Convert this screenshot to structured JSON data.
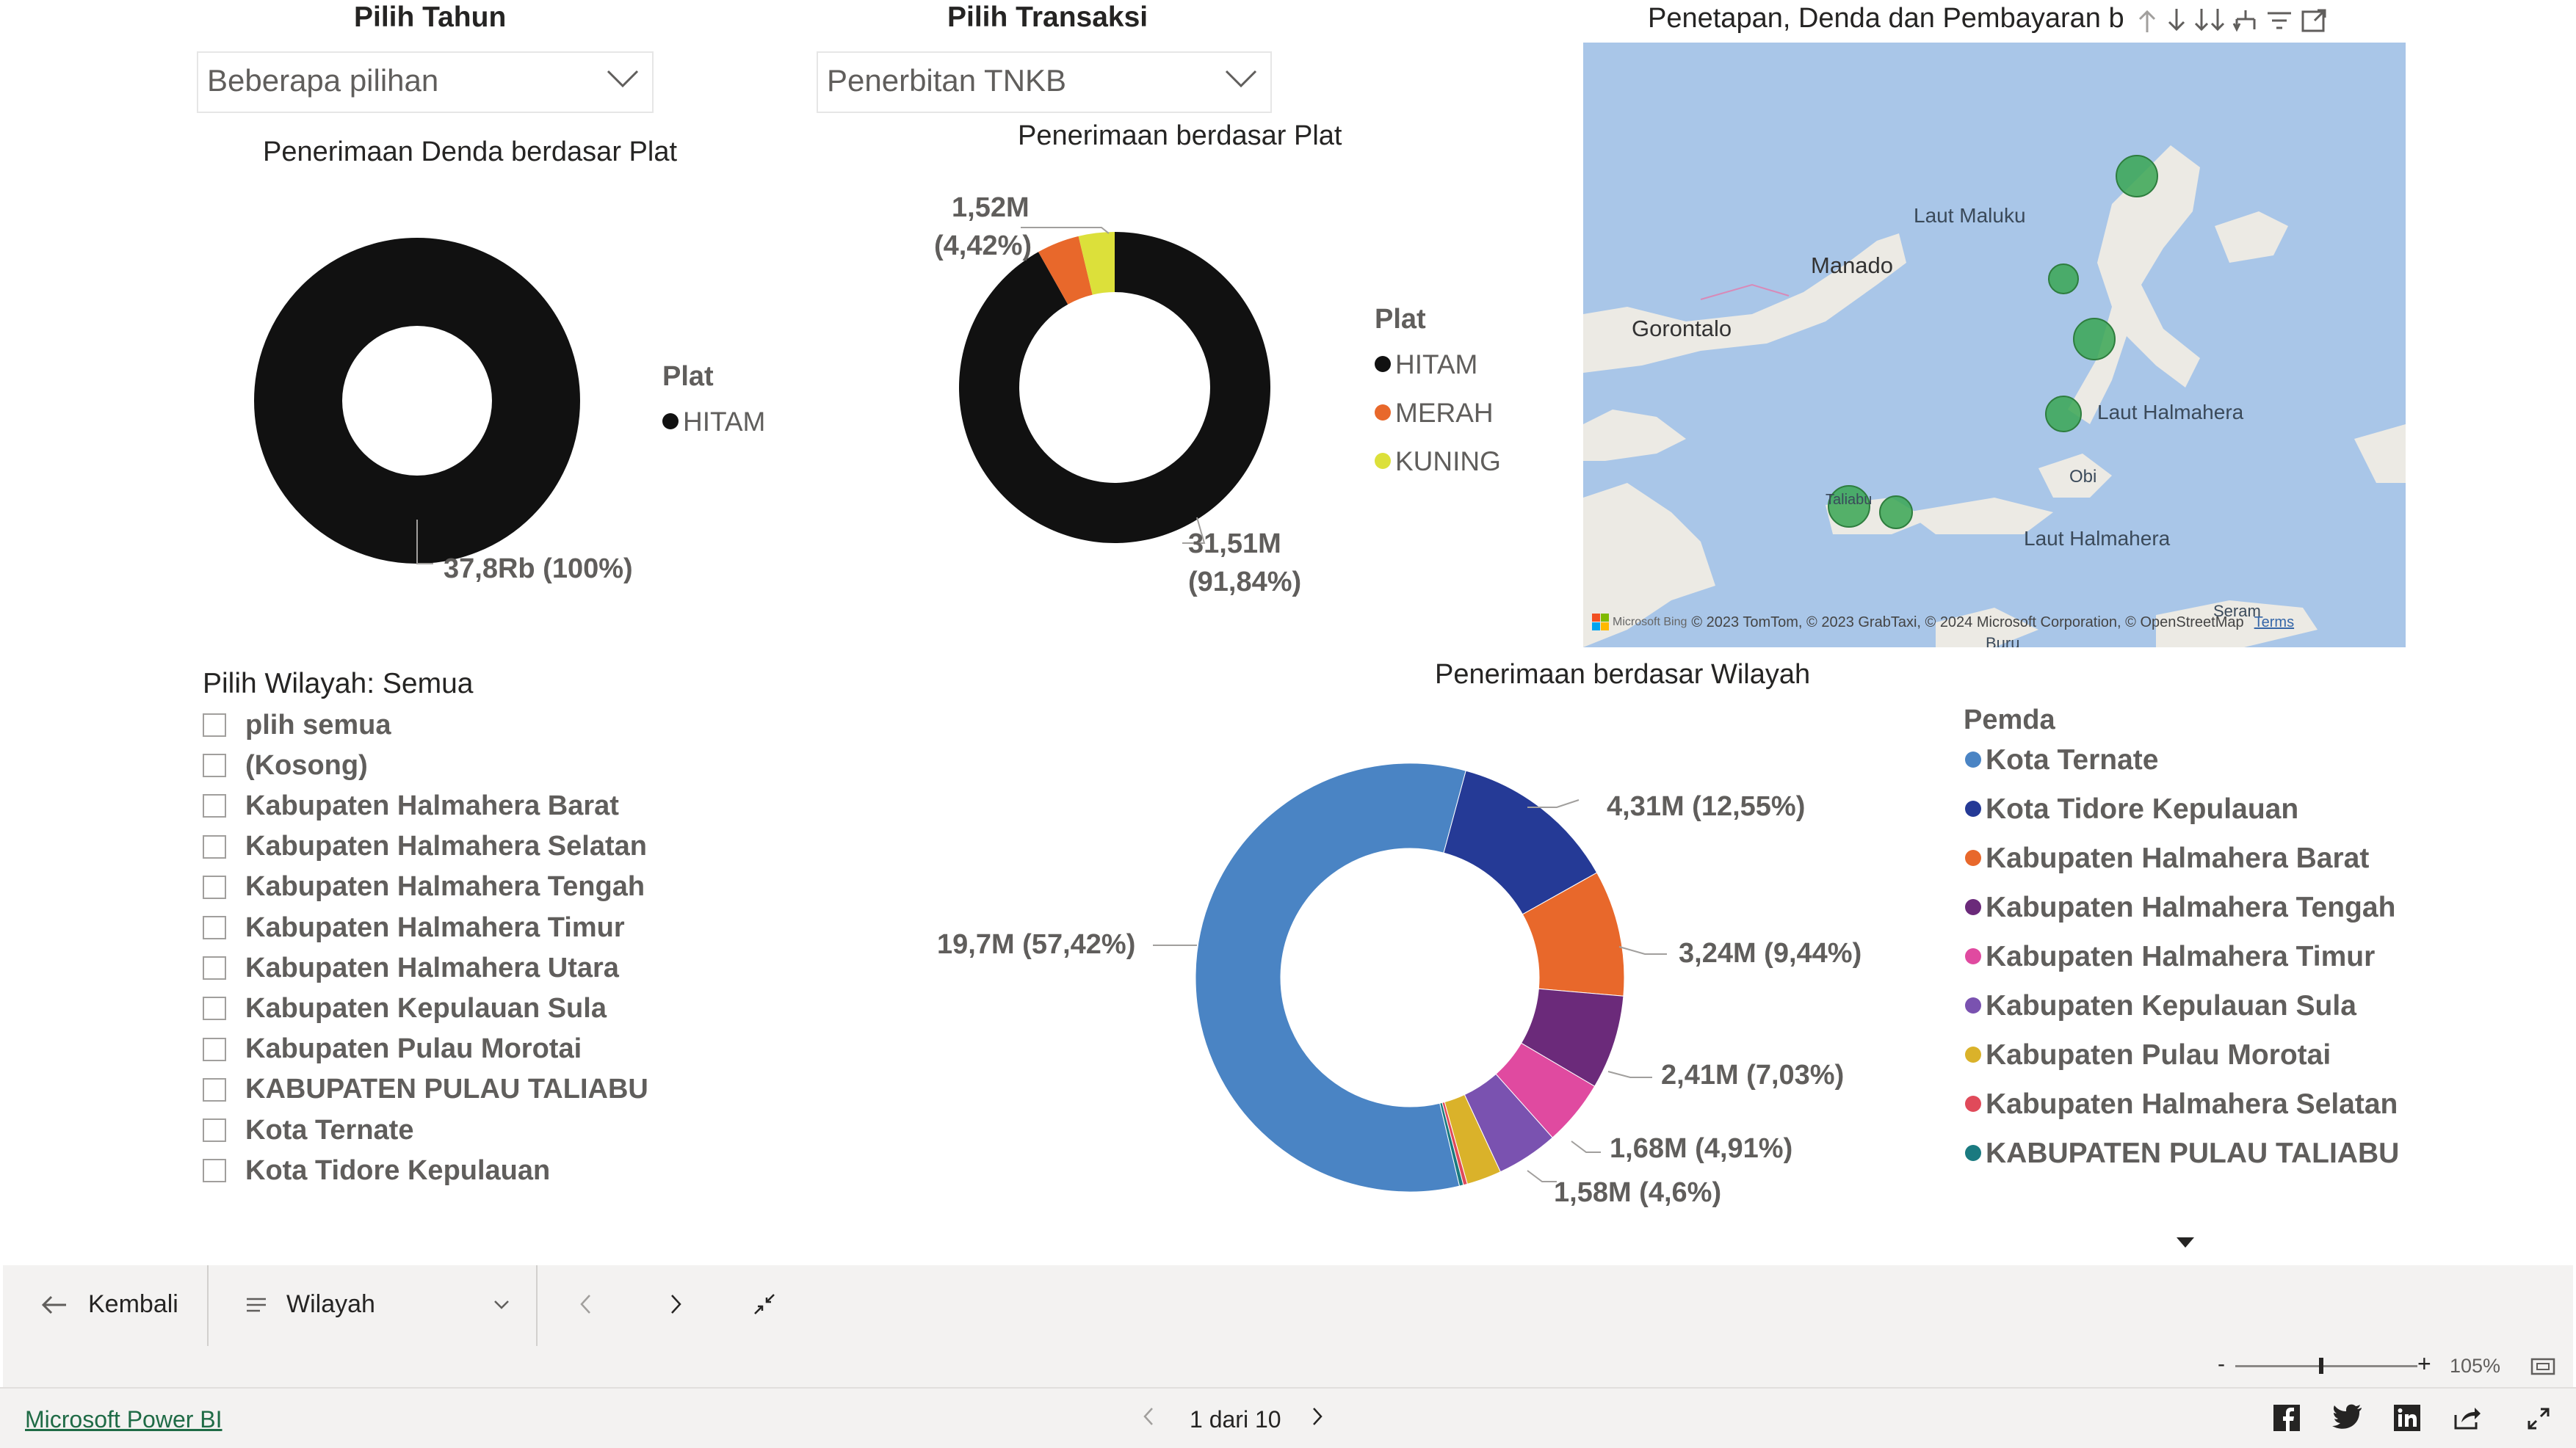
{
  "slicers": {
    "tahun": {
      "title": "Pilih Tahun",
      "value": "Beberapa pilihan"
    },
    "transaksi": {
      "title": "Pilih Transaksi",
      "value": "Penerbitan TNKB"
    }
  },
  "denda_chart": {
    "title": "Penerimaan Denda berdasar Plat",
    "legend_title": "Plat",
    "legend": [
      {
        "label": "HITAM",
        "color": "#111111"
      }
    ],
    "data_labels": [
      "37,8Rb (100%)"
    ]
  },
  "plat_chart": {
    "title": "Penerimaan berdasar Plat",
    "legend_title": "Plat",
    "legend": [
      {
        "label": "HITAM",
        "color": "#111111"
      },
      {
        "label": "MERAH",
        "color": "#e8682b"
      },
      {
        "label": "KUNING",
        "color": "#dce03a"
      }
    ],
    "data_labels": {
      "top_line1": "1,52M",
      "top_line2": "(4,42%)",
      "bottom_line1": "31,51M",
      "bottom_line2": "(91,84%)"
    }
  },
  "map": {
    "title": "Penetapan, Denda dan Pembayaran b",
    "places": {
      "laut_maluku": "Laut Maluku",
      "manado": "Manado",
      "gorontalo": "Gorontalo",
      "laut_halmahera_1": "Laut Halmahera",
      "obi": "Obi",
      "laut_halmahera_2": "Laut Halmahera",
      "taliabu": "Taliabu",
      "seram": "Seram",
      "buru": "Buru"
    },
    "attribution": "© 2023 TomTom, © 2023 GrabTaxi, © 2024 Microsoft Corporation, © OpenStreetMap",
    "terms": "Terms",
    "bing": "Microsoft Bing"
  },
  "wilayah_slicer": {
    "title": "Pilih Wilayah: Semua",
    "items": [
      "plih semua",
      "(Kosong)",
      "Kabupaten Halmahera Barat",
      "Kabupaten Halmahera Selatan",
      "Kabupaten Halmahera Tengah",
      "Kabupaten Halmahera Timur",
      "Kabupaten Halmahera Utara",
      "Kabupaten Kepulauan Sula",
      "Kabupaten Pulau Morotai",
      "KABUPATEN PULAU TALIABU",
      "Kota Ternate",
      "Kota Tidore Kepulauan"
    ]
  },
  "wilayah_chart": {
    "title": "Penerimaan berdasar Wilayah",
    "legend_title": "Pemda",
    "legend": [
      {
        "label": "Kota Ternate",
        "color": "#4a84c4"
      },
      {
        "label": "Kota Tidore Kepulauan",
        "color": "#253a96"
      },
      {
        "label": "Kabupaten Halmahera Barat",
        "color": "#e8682b"
      },
      {
        "label": "Kabupaten Halmahera Tengah",
        "color": "#6b2a7a"
      },
      {
        "label": "Kabupaten Halmahera Timur",
        "color": "#e04aa0"
      },
      {
        "label": "Kabupaten Kepulauan Sula",
        "color": "#7a52b0"
      },
      {
        "label": "Kabupaten Pulau Morotai",
        "color": "#dab22a"
      },
      {
        "label": "Kabupaten Halmahera Selatan",
        "color": "#e04a5a"
      },
      {
        "label": "KABUPATEN PULAU TALIABU",
        "color": "#1a7a80"
      }
    ],
    "data_labels": [
      "19,7M (57,42%)",
      "4,31M (12,55%)",
      "3,24M (9,44%)",
      "2,41M (7,03%)",
      "1,68M (4,91%)",
      "1,58M (4,6%)"
    ]
  },
  "chart_data": [
    {
      "type": "pie",
      "title": "Penerimaan Denda berdasar Plat",
      "categories": [
        "HITAM"
      ],
      "values": [
        100
      ],
      "value_labels": [
        "37,8Rb"
      ]
    },
    {
      "type": "pie",
      "title": "Penerimaan berdasar Plat",
      "categories": [
        "HITAM",
        "MERAH",
        "KUNING"
      ],
      "values": [
        91.84,
        4.42,
        3.74
      ],
      "value_labels": [
        "31,51M",
        "1,52M",
        ""
      ]
    },
    {
      "type": "pie",
      "title": "Penerimaan berdasar Wilayah",
      "categories": [
        "Kota Ternate",
        "Kota Tidore Kepulauan",
        "Kabupaten Halmahera Barat",
        "Kabupaten Halmahera Tengah",
        "Kabupaten Halmahera Timur",
        "Kabupaten Kepulauan Sula",
        "Kabupaten Pulau Morotai",
        "Kabupaten Halmahera Selatan",
        "KABUPATEN PULAU TALIABU"
      ],
      "values": [
        57.42,
        12.55,
        9.44,
        7.03,
        4.91,
        4.6,
        2.6,
        0.3,
        0.3
      ],
      "value_labels": [
        "19,7M",
        "4,31M",
        "3,24M",
        "2,41M",
        "1,68M",
        "1,58M",
        "",
        "",
        ""
      ]
    }
  ],
  "nav": {
    "back": "Kembali",
    "bookmark": "Wilayah"
  },
  "footer": {
    "brand": "Microsoft Power BI",
    "page": "1 dari 10",
    "zoom": "105%"
  }
}
